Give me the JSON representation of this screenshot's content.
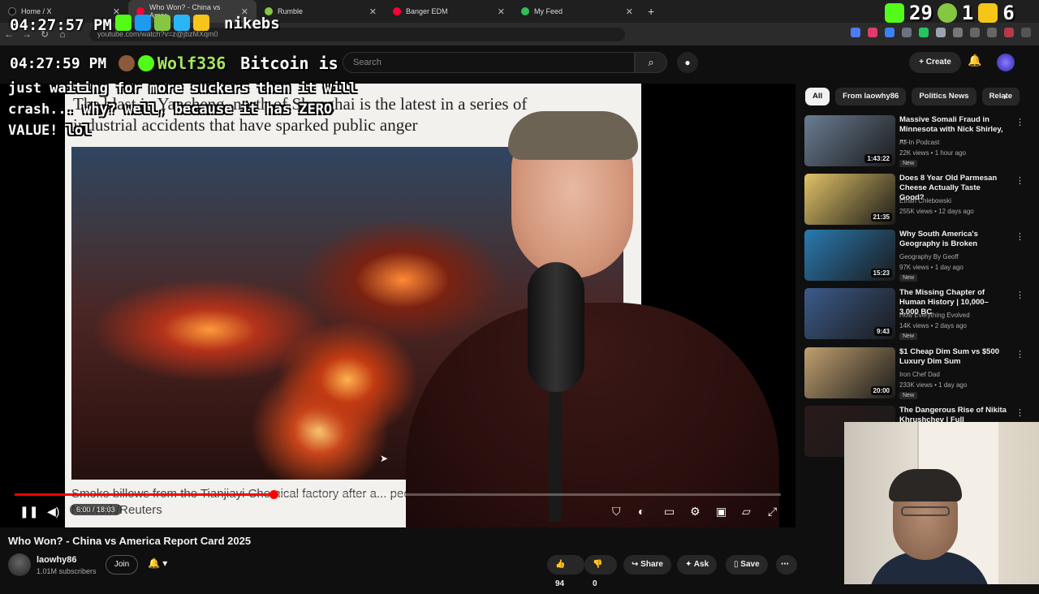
{
  "browser": {
    "tabs": [
      {
        "label": "Home / X",
        "color": "#111111"
      },
      {
        "label": "Who Won? - China vs Amer",
        "color": "#ff0033"
      },
      {
        "label": "Rumble",
        "color": "#85c742"
      },
      {
        "label": "Banger EDM",
        "color": "#ff0033"
      },
      {
        "label": "My Feed",
        "color": "#2fbf57"
      }
    ],
    "url": "youtube.com/watch?v=z@jbzMXqm0"
  },
  "overlay": {
    "clock_top": "04:27:57 PM",
    "clock_chat": "04:27:59 PM",
    "streamer_name": "nikebs",
    "counter_a": "29",
    "counter_b": "1",
    "counter_c": "6",
    "chat_user": "Wolf336",
    "chat_msg_first": "Bitcoin is",
    "chat_msg_rest": "just waiting for more suckers then it will crash... why? well, because it has ZERO VALUE! lol"
  },
  "youtube": {
    "search_placeholder": "Search",
    "create_label": "Create",
    "video": {
      "headline": "The blast in Yancheng, north of Shanghai is the latest in a series of industrial accidents that have sparked public anger",
      "caption": "Smoke billows from the Tianjiayi Chemical factory after a... people dead. Photograph: China Stringer Network/Reuters",
      "time": "6:00 / 18:03",
      "progress": 0.338,
      "title": "Who Won? - China vs America Report Card 2025"
    },
    "channel": {
      "name": "laowhy86",
      "subs": "1.01M subscribers",
      "join": "Join"
    },
    "actions": {
      "likes": "94",
      "dislikes": "0",
      "share": "Share",
      "ask": "Ask",
      "save": "Save"
    },
    "chips": [
      "All",
      "From laowhy86",
      "Politics News",
      "Relate"
    ],
    "recommendations": [
      {
        "title": "Massive Somali Fraud in Minnesota with Nick Shirley, ...",
        "channel": "All-In Podcast",
        "meta": "22K views • 1 hour ago",
        "duration": "1:43:22",
        "new": "New",
        "thumb": "#6a7d93"
      },
      {
        "title": "Does 8 Year Old Parmesan Cheese Actually Taste Good?",
        "channel": "Ethan Chlebowski",
        "meta": "255K views • 12 days ago",
        "duration": "21:35",
        "new": "",
        "thumb": "#e0c267"
      },
      {
        "title": "Why South America's Geography is Broken",
        "channel": "Geography By Geoff",
        "meta": "97K views • 1 day ago",
        "duration": "15:23",
        "new": "New",
        "thumb": "#2a7ab0"
      },
      {
        "title": "The Missing Chapter of Human History | 10,000–3,000 BC",
        "channel": "How Everything Evolved",
        "meta": "14K views • 2 days ago",
        "duration": "9:43",
        "new": "New",
        "thumb": "#3c5b8a"
      },
      {
        "title": "$1 Cheap Dim Sum vs $500 Luxury Dim Sum",
        "channel": "Iron Chef Dad",
        "meta": "233K views • 1 day ago",
        "duration": "20:00",
        "new": "New",
        "thumb": "#c0a070"
      },
      {
        "title": "The Dangerous Rise of Nikita Khrushchev | Full Documentary",
        "channel": "",
        "meta": "",
        "duration": "",
        "new": "",
        "thumb": "#2a1a1a"
      }
    ]
  }
}
